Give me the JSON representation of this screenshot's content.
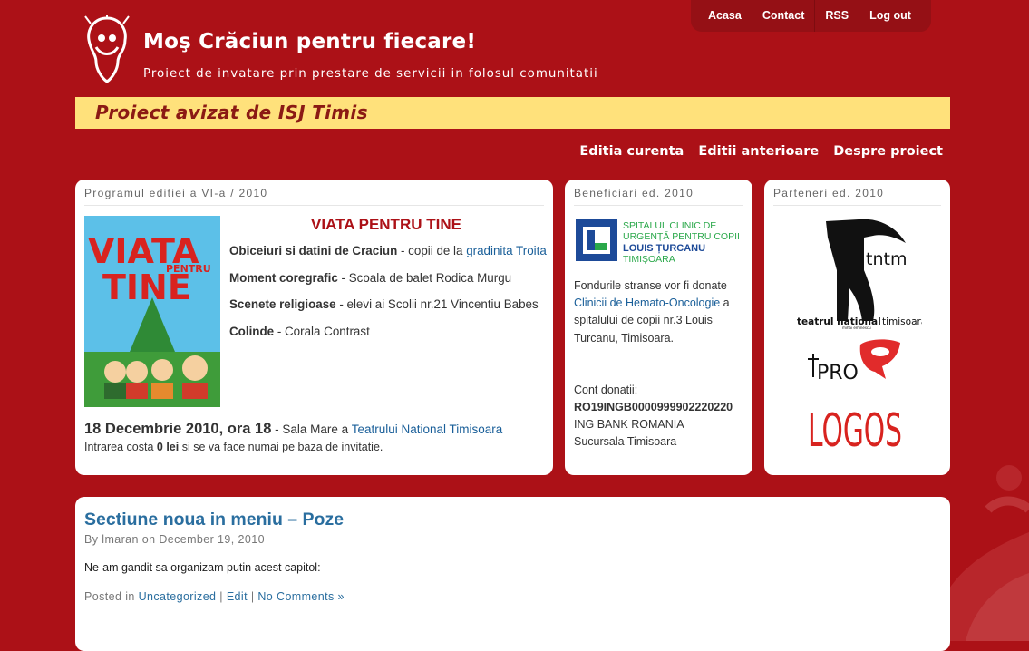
{
  "site": {
    "title": "Moş Crăciun pentru fiecare!",
    "tagline": "Proiect de invatare prin prestare de servicii in folosul comunitatii",
    "banner": "Proiect avizat de ISJ Timis"
  },
  "topnav": [
    "Acasa",
    "Contact",
    "RSS",
    "Log out"
  ],
  "mainnav": [
    "Editia curenta",
    "Editii anterioare",
    "Despre proiect"
  ],
  "program": {
    "heading": "Programul editiei a VI-a / 2010",
    "event_title": "VIATA PENTRU TINE",
    "poster": {
      "line1": "VIATA",
      "line2": "PENTRU",
      "line3": "TINE"
    },
    "items": [
      {
        "name": "Obiceiuri si datini de Craciun",
        "sep": " - copii de la ",
        "link": "gradinita Troita",
        "desc": ""
      },
      {
        "name": "Moment coregrafic",
        "sep": " - Scoala de balet Rodica Murgu",
        "link": "",
        "desc": ""
      },
      {
        "name": "Scenete religioase",
        "sep": " - elevi ai Scolii nr.21 Vincentiu Babes",
        "link": "",
        "desc": ""
      },
      {
        "name": "Colinde",
        "sep": " - Corala Contrast",
        "link": "",
        "desc": ""
      }
    ],
    "date": "18 Decembrie 2010, ora 18",
    "date_sep": " - Sala Mare a ",
    "venue_link": "Teatrului National Timisoara",
    "entry_pre": "Intrarea costa ",
    "entry_price": "0 lei",
    "entry_post": " si se va face numai pe baza de invitatie."
  },
  "beneficiari": {
    "heading": "Beneficiari ed. 2010",
    "hospital_logo": {
      "line1": "SPITALUL CLINIC DE",
      "line2": "URGENȚĂ PENTRU COPII",
      "line3": "LOUIS ȚURCANU",
      "line4": "TIMIȘOARA"
    },
    "text1": "Fondurile stranse vor fi donate",
    "text_link": "Clinicii de Hemato-Oncologie",
    "text2": " a spitalului de copii nr.3 Louis Turcanu, Timisoara.",
    "cont_label": "Cont donatii:",
    "iban": "RO19INGB0000999902220220",
    "bank": "ING BANK ROMANIA",
    "branch": "Sucursala Timisoara"
  },
  "parteneri": {
    "heading": "Parteneri ed. 2010",
    "tntm": {
      "mark": "tntm",
      "line1": "teatrul national",
      "line2": "timisoara",
      "small": "mihai eminescu"
    },
    "prologos": {
      "line1": "PRO",
      "line2": "LOGOS"
    }
  },
  "post": {
    "title": "Sectiune noua in meniu – Poze",
    "meta_by": "By ",
    "author": "lmaran",
    "meta_on": " on ",
    "date": "December 19, 2010",
    "body": "Ne-am gandit sa organizam putin acest capitol:",
    "posted_in": "Posted in ",
    "category": "Uncategorized",
    "sep": " | ",
    "edit": "Edit",
    "comments": "No Comments »"
  },
  "colors": {
    "background": "#ac1117",
    "banner": "#ffe17b",
    "link": "#1a5f99",
    "title_red": "#ac1117"
  }
}
